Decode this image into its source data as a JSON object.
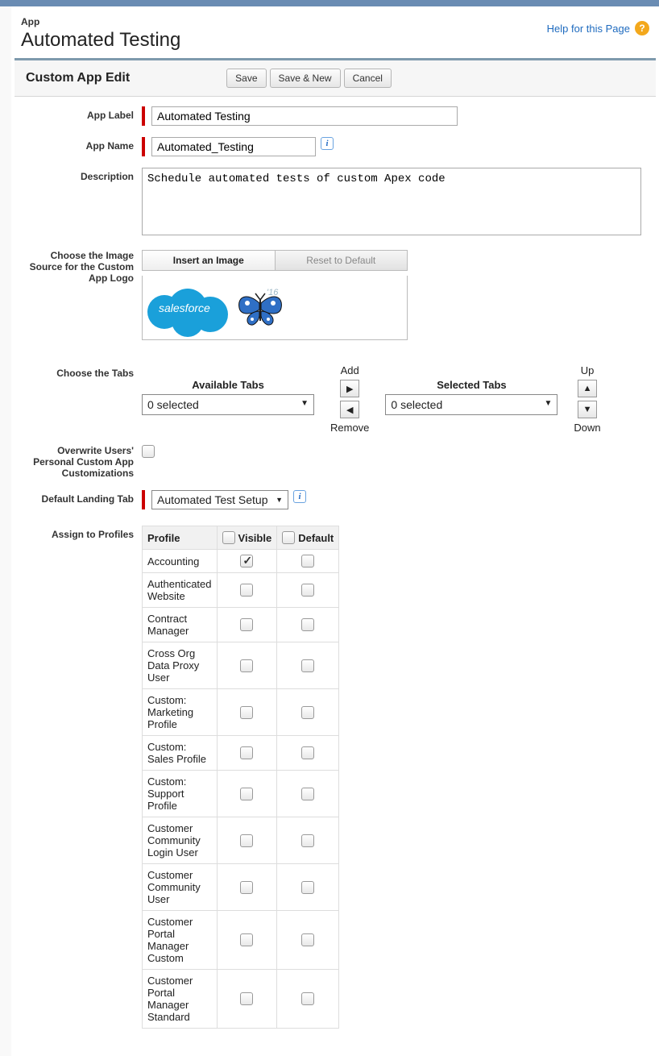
{
  "header": {
    "subtitle": "App",
    "title": "Automated Testing",
    "help_link": "Help for this Page"
  },
  "section": {
    "title": "Custom App Edit"
  },
  "buttons": {
    "save": "Save",
    "save_new": "Save & New",
    "cancel": "Cancel"
  },
  "labels": {
    "app_label": "App Label",
    "app_name": "App Name",
    "description": "Description",
    "image_source": "Choose the Image Source for the Custom App Logo",
    "choose_tabs": "Choose the Tabs",
    "overwrite": "Overwrite Users' Personal Custom App Customizations",
    "default_landing": "Default Landing Tab",
    "assign_profiles": "Assign to Profiles"
  },
  "values": {
    "app_label": "Automated Testing",
    "app_name": "Automated_Testing",
    "description": "Schedule automated tests of custom Apex code",
    "default_landing": "Automated Test Setup"
  },
  "logo_tabs": {
    "insert": "Insert an Image",
    "reset": "Reset to Default",
    "version": "'16"
  },
  "tabs": {
    "available": "Available Tabs",
    "selected": "Selected Tabs",
    "add": "Add",
    "remove": "Remove",
    "up": "Up",
    "down": "Down",
    "available_count": "0 selected",
    "selected_count": "0 selected"
  },
  "profile_headers": {
    "profile": "Profile",
    "visible": "Visible",
    "default": "Default"
  },
  "profiles": [
    {
      "name": "Accounting",
      "visible": true,
      "default": false
    },
    {
      "name": "Authenticated Website",
      "visible": false,
      "default": false
    },
    {
      "name": "Contract Manager",
      "visible": false,
      "default": false
    },
    {
      "name": "Cross Org Data Proxy User",
      "visible": false,
      "default": false
    },
    {
      "name": "Custom: Marketing Profile",
      "visible": false,
      "default": false
    },
    {
      "name": "Custom: Sales Profile",
      "visible": false,
      "default": false
    },
    {
      "name": "Custom: Support Profile",
      "visible": false,
      "default": false
    },
    {
      "name": "Customer Community Login User",
      "visible": false,
      "default": false
    },
    {
      "name": "Customer Community User",
      "visible": false,
      "default": false
    },
    {
      "name": "Customer Portal Manager Custom",
      "visible": false,
      "default": false
    },
    {
      "name": "Customer Portal Manager Standard",
      "visible": false,
      "default": false
    }
  ]
}
